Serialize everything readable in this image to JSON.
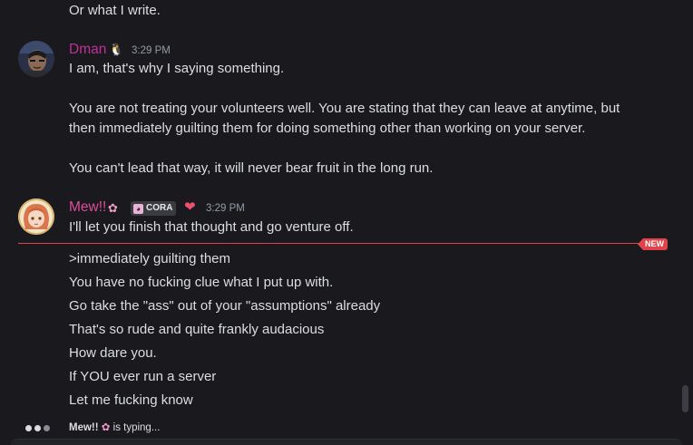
{
  "messages": {
    "prev_tail": "Or what I write.",
    "dman": {
      "username": "Dman",
      "badge": "penguin-icon",
      "time": "3:29 PM",
      "color": "#c22f9a",
      "lines": [
        "I am, that's why I saying something.",
        "You are not treating your volunteers well. You are stating that they can leave at anytime, but",
        "then immediately guilting them for doing something other than working on your server.",
        "You can't lead that way, it will never bear fruit in the long run."
      ]
    },
    "mew": {
      "username": "Mew!!",
      "badge": "cherry-blossom-icon",
      "tag_label": "CORA",
      "tag_icon": "cat-face-icon",
      "heart_icon": "heart-icon",
      "time": "3:29 PM",
      "color": "#e04c9c",
      "first_line": "I'll let you finish that thought and go venture off.",
      "new_label": "NEW",
      "lines": [
        ">immediately guilting them",
        "You have no fucking clue what I put up with.",
        "Go take the \"ass\" out of your \"assumptions\" already",
        "That's so rude and quite frankly audacious",
        "How dare you.",
        "If YOU ever run a server",
        "Let me fucking know"
      ]
    }
  },
  "typing": {
    "name": "Mew!!",
    "suffix": "is typing..."
  },
  "colors": {
    "background": "#1a1a1e",
    "new_divider": "#e0444a"
  }
}
